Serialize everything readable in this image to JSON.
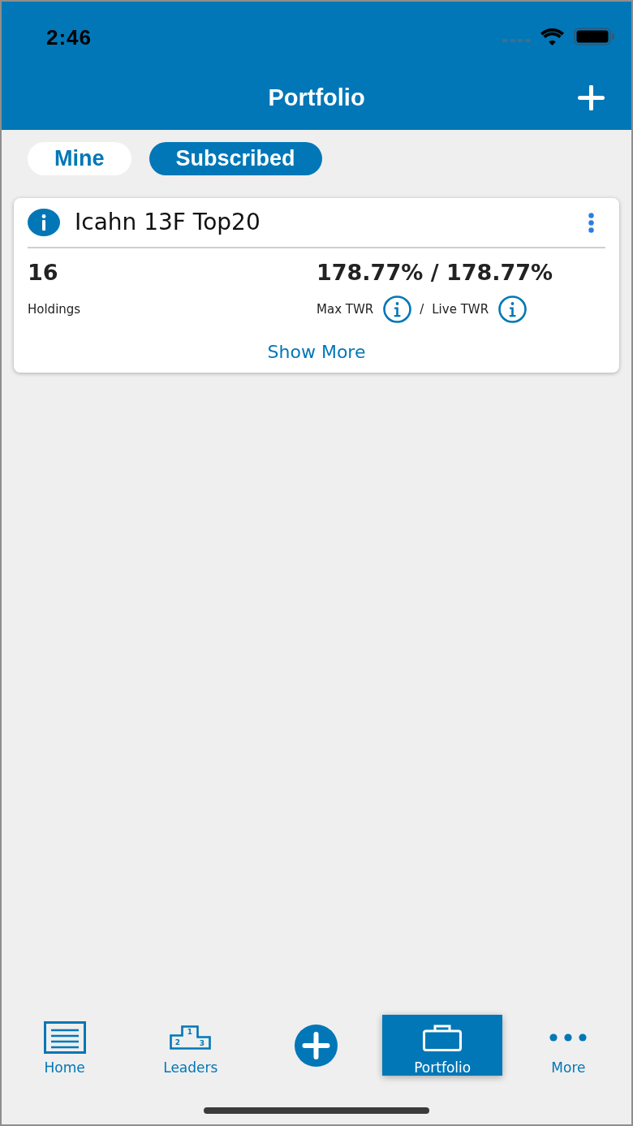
{
  "status_bar": {
    "time": "2:46"
  },
  "header": {
    "title": "Portfolio"
  },
  "tabs": [
    {
      "label": "Mine",
      "selected": false
    },
    {
      "label": "Subscribed",
      "selected": true
    }
  ],
  "portfolios": [
    {
      "name": "Icahn 13F Top20",
      "holdings": "16",
      "holdings_label": "Holdings",
      "twr": "178.77% / 178.77%",
      "max_twr_label": "Max TWR",
      "separator": "/",
      "live_twr_label": "Live TWR",
      "show_more": "Show More"
    }
  ],
  "bottom_nav": [
    {
      "kind": "home",
      "label": "Home",
      "selected": false
    },
    {
      "kind": "leaders",
      "label": "Leaders",
      "selected": false,
      "icon_text": [
        "1",
        "2",
        "3"
      ]
    },
    {
      "kind": "add",
      "selected": false
    },
    {
      "kind": "portfolio",
      "label": "Portfolio",
      "selected": true
    },
    {
      "kind": "more",
      "label": "More",
      "selected": false
    }
  ]
}
